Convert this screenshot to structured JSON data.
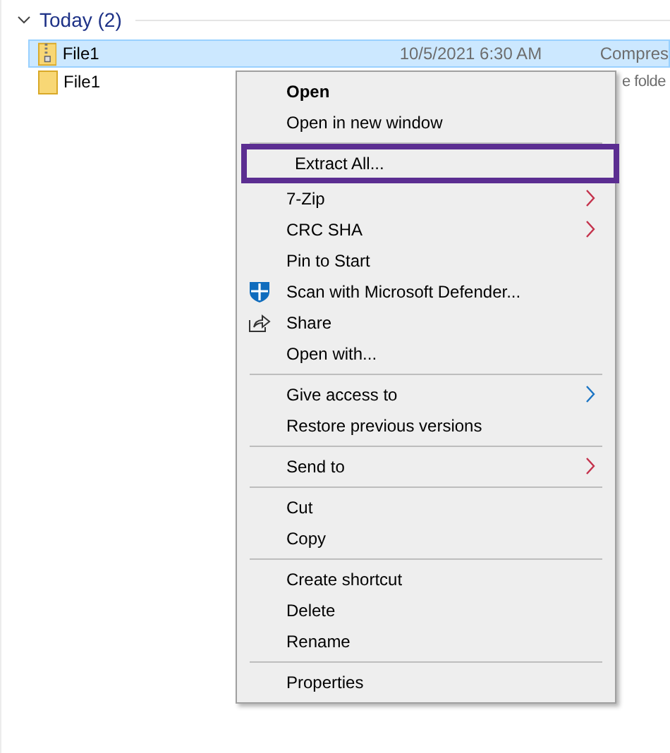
{
  "group": {
    "title": "Today (2)",
    "expanded": true
  },
  "files": [
    {
      "name": "File1",
      "kind": "zip",
      "selected": true,
      "date": "10/5/2021 6:30 AM",
      "type": "Compres"
    },
    {
      "name": "File1",
      "kind": "folder",
      "selected": false,
      "type": "e folde"
    }
  ],
  "context_menu": [
    {
      "kind": "item",
      "label": "Open",
      "default": true
    },
    {
      "kind": "item",
      "label": "Open in new window"
    },
    {
      "kind": "separator"
    },
    {
      "kind": "item",
      "label": "Extract All...",
      "highlighted": true
    },
    {
      "kind": "item",
      "label": "7-Zip",
      "submenu": true,
      "color": "#c4314b"
    },
    {
      "kind": "item",
      "label": "CRC SHA",
      "submenu": true,
      "color": "#c4314b"
    },
    {
      "kind": "item",
      "label": "Pin to Start"
    },
    {
      "kind": "scan",
      "label": "Scan with Microsoft Defender..."
    },
    {
      "kind": "share",
      "label": "Share"
    },
    {
      "kind": "item",
      "label": "Open with..."
    },
    {
      "kind": "separator"
    },
    {
      "kind": "item",
      "label": "Give access to",
      "submenu": true,
      "color": "#1a74c4"
    },
    {
      "kind": "item",
      "label": "Restore previous versions"
    },
    {
      "kind": "separator"
    },
    {
      "kind": "item",
      "label": "Send to",
      "submenu": true,
      "color": "#c4314b"
    },
    {
      "kind": "separator"
    },
    {
      "kind": "item",
      "label": "Cut"
    },
    {
      "kind": "item",
      "label": "Copy"
    },
    {
      "kind": "separator"
    },
    {
      "kind": "item",
      "label": "Create shortcut"
    },
    {
      "kind": "item",
      "label": "Delete"
    },
    {
      "kind": "item",
      "label": "Rename"
    },
    {
      "kind": "separator"
    },
    {
      "kind": "item",
      "label": "Properties"
    }
  ]
}
